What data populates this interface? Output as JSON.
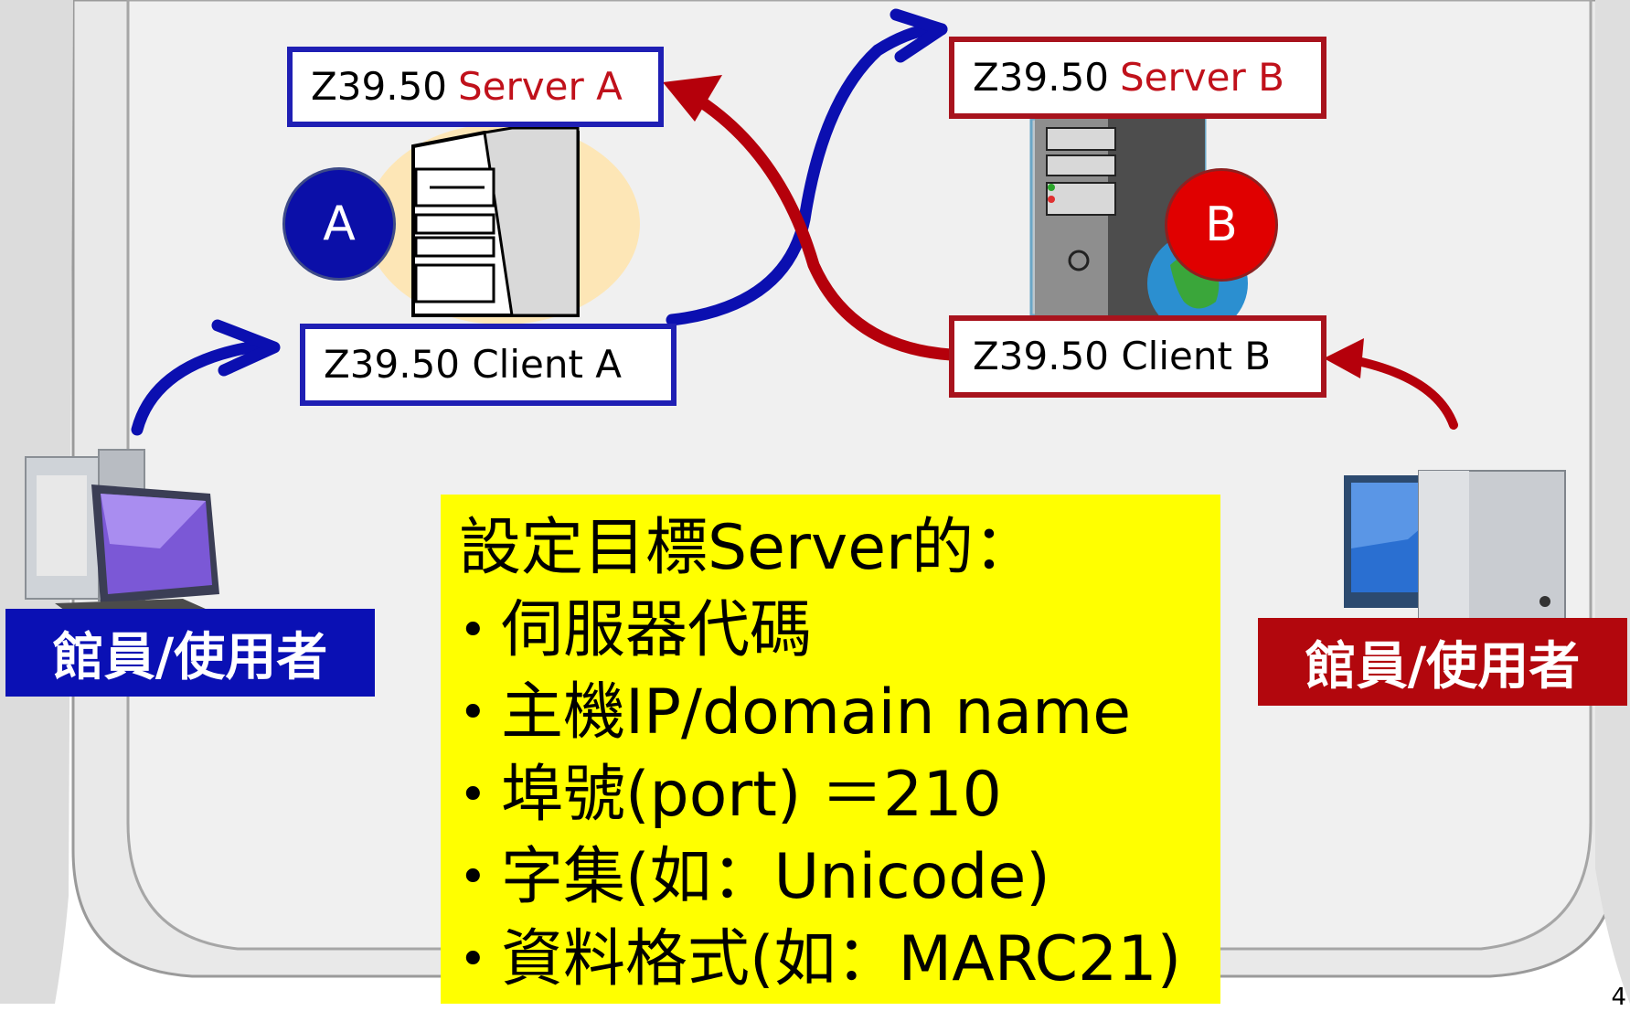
{
  "server_a": {
    "prefix": "Z39.50",
    "name": "Server A"
  },
  "server_b": {
    "prefix": "Z39.50",
    "name": "Server B"
  },
  "client_a": {
    "label": "Z39.50 Client A"
  },
  "client_b": {
    "label": "Z39.50 Client B"
  },
  "badge_a": "A",
  "badge_b": "B",
  "user_left": "館員/使用者",
  "user_right": "館員/使用者",
  "settings": {
    "heading": "設定目標Server的：",
    "items": [
      "伺服器代碼",
      "主機IP/domain name",
      "埠號(port) ＝210",
      "字集(如：Unicode)",
      "資料格式(如：MARC21)"
    ]
  },
  "page_number": "4",
  "colors": {
    "blue": "#1f1fb4",
    "red": "#a8131d",
    "highlight": "#ffff00"
  },
  "icons": {
    "server_a": "server-tower-icon",
    "server_b": "server-globe-icon",
    "user_left": "desktop-computer-icon",
    "user_right": "desktop-computer-icon"
  }
}
